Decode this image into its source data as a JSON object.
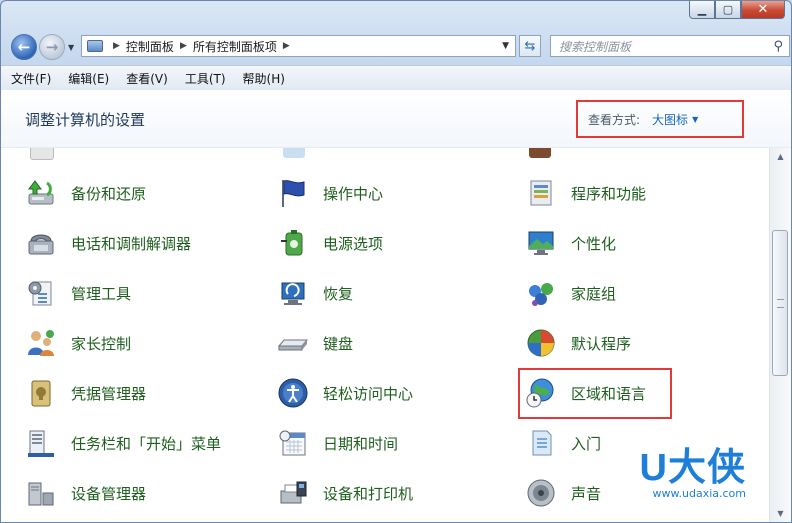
{
  "window": {
    "caption": {
      "minimize": "▁",
      "maximize": "▢",
      "close": "✕"
    }
  },
  "navigation": {
    "back_icon": "arrow-left-icon",
    "forward_icon": "arrow-right-icon",
    "breadcrumb": [
      "控制面板",
      "所有控制面板项"
    ],
    "search_placeholder": "搜索控制面板"
  },
  "menubar": {
    "items": [
      "文件(F)",
      "编辑(E)",
      "查看(V)",
      "工具(T)",
      "帮助(H)"
    ]
  },
  "header": {
    "title": "调整计算机的设置",
    "view_by_label": "查看方式:",
    "view_by_value": "大图标"
  },
  "items": [
    {
      "label": "备份和还原",
      "icon": "backup-restore-icon"
    },
    {
      "label": "操作中心",
      "icon": "action-center-flag-icon"
    },
    {
      "label": "程序和功能",
      "icon": "programs-features-icon"
    },
    {
      "label": "电话和调制解调器",
      "icon": "phone-modem-icon"
    },
    {
      "label": "电源选项",
      "icon": "power-options-icon"
    },
    {
      "label": "个性化",
      "icon": "personalization-icon"
    },
    {
      "label": "管理工具",
      "icon": "admin-tools-icon"
    },
    {
      "label": "恢复",
      "icon": "recovery-icon"
    },
    {
      "label": "家庭组",
      "icon": "homegroup-icon"
    },
    {
      "label": "家长控制",
      "icon": "parental-controls-icon"
    },
    {
      "label": "键盘",
      "icon": "keyboard-icon"
    },
    {
      "label": "默认程序",
      "icon": "default-programs-icon"
    },
    {
      "label": "凭据管理器",
      "icon": "credential-manager-icon"
    },
    {
      "label": "轻松访问中心",
      "icon": "ease-of-access-icon"
    },
    {
      "label": "区域和语言",
      "icon": "region-language-globe-icon"
    },
    {
      "label": "任务栏和「开始」菜单",
      "icon": "taskbar-start-menu-icon"
    },
    {
      "label": "日期和时间",
      "icon": "date-time-icon"
    },
    {
      "label": "入门",
      "icon": "getting-started-icon"
    },
    {
      "label": "设备管理器",
      "icon": "device-manager-icon"
    },
    {
      "label": "设备和打印机",
      "icon": "devices-printers-icon"
    },
    {
      "label": "声音",
      "icon": "sound-speaker-icon"
    }
  ],
  "watermark": {
    "brand": "U大侠",
    "url": "www.udaxia.com"
  },
  "colors": {
    "link_green": "#1e5e1e",
    "highlight_red": "#e23a3a",
    "accent_blue": "#1466c0"
  }
}
